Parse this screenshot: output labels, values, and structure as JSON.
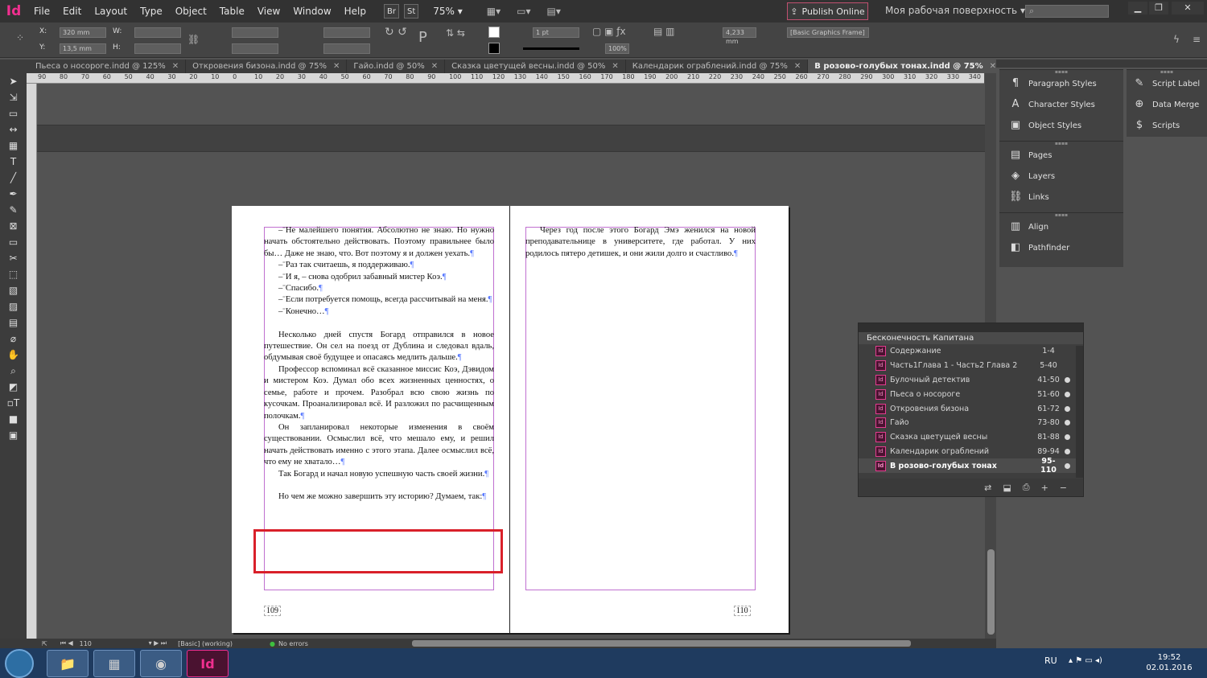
{
  "app": {
    "logo": "Id",
    "menu": [
      "File",
      "Edit",
      "Layout",
      "Type",
      "Object",
      "Table",
      "View",
      "Window",
      "Help"
    ],
    "bridge": "Br",
    "stock": "St",
    "zoom": "75%",
    "publish": "Publish Online",
    "workspace": "Моя рабочая поверхность",
    "search_placeholder": ""
  },
  "control": {
    "x_label": "X:",
    "x_value": "320 mm",
    "y_label": "Y:",
    "y_value": "13,5 mm",
    "w_label": "W:",
    "h_label": "H:",
    "stroke_weight": "1 pt",
    "scale": "100%",
    "width_value": "4,233 mm",
    "frame_style": "[Basic Graphics Frame]"
  },
  "tabs": [
    {
      "label": "Пьеса о носороге.indd @ 125%"
    },
    {
      "label": "Откровения бизона.indd @ 75%"
    },
    {
      "label": "Гайо.indd @ 50%"
    },
    {
      "label": "Сказка цветущей весны.indd @ 50%"
    },
    {
      "label": "Календарик ограблений.indd @ 75%"
    },
    {
      "label": "В розово-голубых тонах.indd @ 75%"
    }
  ],
  "ruler_ticks": [
    "90",
    "80",
    "70",
    "60",
    "50",
    "40",
    "30",
    "20",
    "10",
    "0",
    "10",
    "20",
    "30",
    "40",
    "50",
    "60",
    "70",
    "80",
    "90",
    "100",
    "110",
    "120",
    "130",
    "140",
    "150",
    "160",
    "170",
    "180",
    "190",
    "200",
    "210",
    "220",
    "230",
    "240",
    "250",
    "260",
    "270",
    "280",
    "290",
    "300",
    "310",
    "320",
    "330",
    "340"
  ],
  "left_page": {
    "paragraphs": [
      "–¨Не малейшего понятия. Абсолютно не знаю. Но нужно начать обстоятельно действовать. Поэтому правильнее было бы… Даже не знаю, что. Вот поэтому я и должен уехать.",
      "–¨Раз так считаешь, я поддерживаю.",
      "–¨И я, – снова одобрил забавный мистер Коэ.",
      "–¨Спасибо.",
      "–¨Если потребуется помощь, всегда рассчитывай на меня.",
      "–¨Конечно…",
      "",
      "Несколько дней спустя Богард отправился в новое путешествие. Он сел на поезд от Дублина и следовал вдаль, обдумывая своё будущее и опасаясь медлить дальше.",
      "Профессор вспоминал всё сказанное миссис Коэ, Дэвидом и мистером Коэ. Думал обо всех жизненных ценностях, о семье, работе и прочем. Разобрал всю свою жизнь по кусочкам. Проанализировал всё. И разложил по расчищенным полочкам.",
      "Он запланировал некоторые изменения в своём существовании. Осмыслил всё, что мешало ему, и решил начать действовать именно с этого этапа. Далее осмыслил всё, что ему не хватало…",
      "Так Богард и начал новую успешную часть своей жизни.",
      "",
      "Но чем же можно завершить эту историю? Думаем, так:"
    ],
    "page_number": "109"
  },
  "right_page": {
    "paragraphs": [
      "Через год после этого Богард Эмэ женился на новой преподавательнице в университете, где работал. У них родилось пятеро детишек, и они жили долго и счастливо."
    ],
    "page_number": "110"
  },
  "pilcrow": "¶",
  "panels": {
    "col1": [
      {
        "label": "Paragraph Styles",
        "icon": "¶"
      },
      {
        "label": "Character Styles",
        "icon": "A"
      },
      {
        "label": "Object Styles",
        "icon": "▣"
      }
    ],
    "col1b": [
      {
        "label": "Pages",
        "icon": "▤"
      },
      {
        "label": "Layers",
        "icon": "◈"
      },
      {
        "label": "Links",
        "icon": "⛓"
      }
    ],
    "col1c": [
      {
        "label": "Align",
        "icon": "▥"
      },
      {
        "label": "Pathfinder",
        "icon": "◧"
      }
    ],
    "col2": [
      {
        "label": "Script Label",
        "icon": "✎"
      },
      {
        "label": "Data Merge",
        "icon": "⊕"
      },
      {
        "label": "Scripts",
        "icon": "$"
      }
    ]
  },
  "book": {
    "title": "Бесконечность Капитана",
    "items": [
      {
        "name": "Содержание",
        "pages": "1-4",
        "dot": false
      },
      {
        "name": "Часть1Глава 1 - Часть2 Глава 2",
        "pages": "5-40",
        "dot": false
      },
      {
        "name": "Булочный детектив",
        "pages": "41-50",
        "dot": true
      },
      {
        "name": "Пьеса о носороге",
        "pages": "51-60",
        "dot": true
      },
      {
        "name": "Откровения бизона",
        "pages": "61-72",
        "dot": true
      },
      {
        "name": "Гайо",
        "pages": "73-80",
        "dot": true
      },
      {
        "name": "Сказка цветущей весны",
        "pages": "81-88",
        "dot": true
      },
      {
        "name": "Календарик ограблений",
        "pages": "89-94",
        "dot": true
      },
      {
        "name": "В розово-голубых тонах",
        "pages": "95-110",
        "dot": true
      }
    ]
  },
  "status": {
    "page": "110",
    "preflight_profile": "[Basic] (working)",
    "errors": "No errors"
  },
  "taskbar": {
    "lang": "RU",
    "time": "19:52",
    "date": "02.01.2016"
  },
  "colors": {
    "accent": "#f02f8f",
    "highlight": "#d9202a",
    "margin": "#c070d0"
  }
}
